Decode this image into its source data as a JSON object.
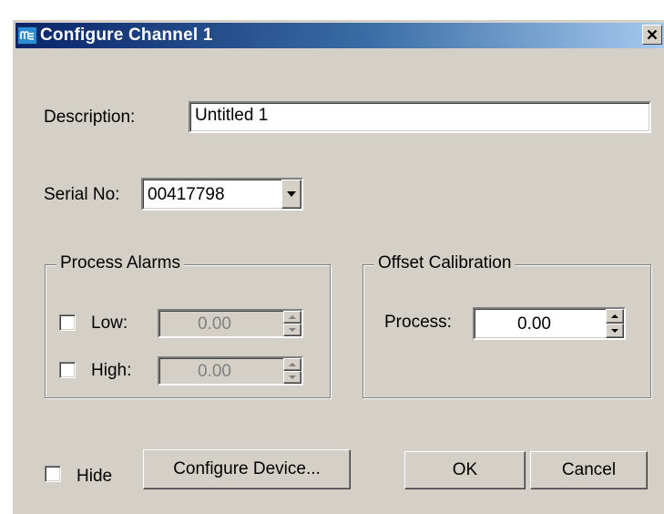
{
  "window": {
    "title": "Configure Channel 1",
    "close_glyph": "✕",
    "app_icon": "channel-app-icon"
  },
  "description": {
    "label": "Description:",
    "value": "Untitled 1"
  },
  "serial": {
    "label": "Serial No:",
    "value": "00417798"
  },
  "process_alarms": {
    "title": "Process Alarms",
    "low": {
      "label": "Low:",
      "value": "0.00",
      "checked": false,
      "enabled": false
    },
    "high": {
      "label": "High:",
      "value": "0.00",
      "checked": false,
      "enabled": false
    }
  },
  "offset_calibration": {
    "title": "Offset Calibration",
    "process": {
      "label": "Process:",
      "value": "0.00"
    }
  },
  "hide": {
    "label": "Hide",
    "checked": false
  },
  "buttons": {
    "configure_device": "Configure Device...",
    "ok": "OK",
    "cancel": "Cancel"
  },
  "colors": {
    "face": "#d4d0c8",
    "title_start": "#0a246a",
    "title_end": "#a6caf0"
  }
}
